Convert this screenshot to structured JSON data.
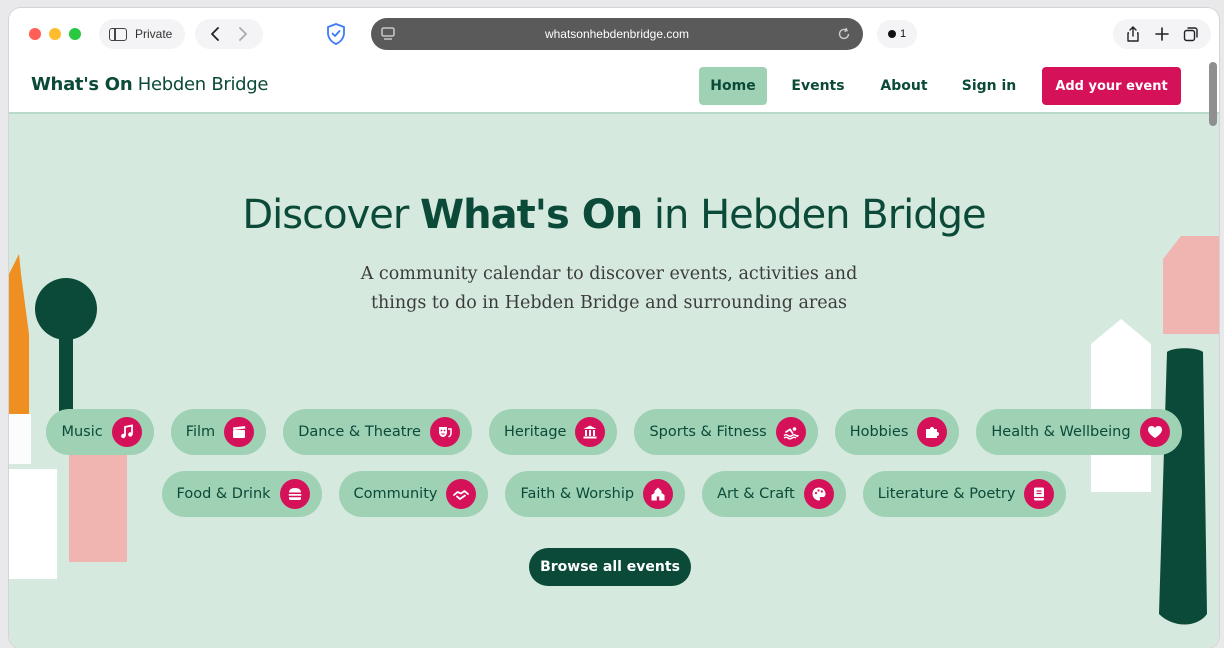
{
  "browser": {
    "private_label": "Private",
    "url": "whatsonhebdenbridge.com",
    "extension_count": "1"
  },
  "site": {
    "logo_bold": "What's On",
    "logo_light": "Hebden Bridge",
    "nav": {
      "home": "Home",
      "events": "Events",
      "about": "About",
      "sign_in": "Sign in",
      "add_event": "Add your event"
    }
  },
  "hero": {
    "title_pre": "Discover",
    "title_bold": "What's On",
    "title_post": "in Hebden Bridge",
    "subtitle_line1": "A community calendar to discover events, activities and",
    "subtitle_line2": "things to do in Hebden Bridge and surrounding areas",
    "browse_label": "Browse all events"
  },
  "categories": {
    "row1": [
      {
        "label": "Music",
        "icon": "music-note-icon"
      },
      {
        "label": "Film",
        "icon": "clapperboard-icon"
      },
      {
        "label": "Dance & Theatre",
        "icon": "theatre-masks-icon"
      },
      {
        "label": "Heritage",
        "icon": "landmark-icon"
      },
      {
        "label": "Sports & Fitness",
        "icon": "swimmer-icon"
      },
      {
        "label": "Hobbies",
        "icon": "puzzle-piece-icon"
      },
      {
        "label": "Health & Wellbeing",
        "icon": "heart-icon"
      }
    ],
    "row2": [
      {
        "label": "Food & Drink",
        "icon": "burger-icon"
      },
      {
        "label": "Community",
        "icon": "handshake-icon"
      },
      {
        "label": "Faith & Worship",
        "icon": "place-of-worship-icon"
      },
      {
        "label": "Art & Craft",
        "icon": "palette-icon"
      },
      {
        "label": "Literature & Poetry",
        "icon": "book-icon"
      }
    ]
  },
  "colors": {
    "brand_green": "#0b4a38",
    "chip_green": "#9fd1b5",
    "hero_bg": "#d5e9de",
    "accent_pink": "#d41159"
  }
}
